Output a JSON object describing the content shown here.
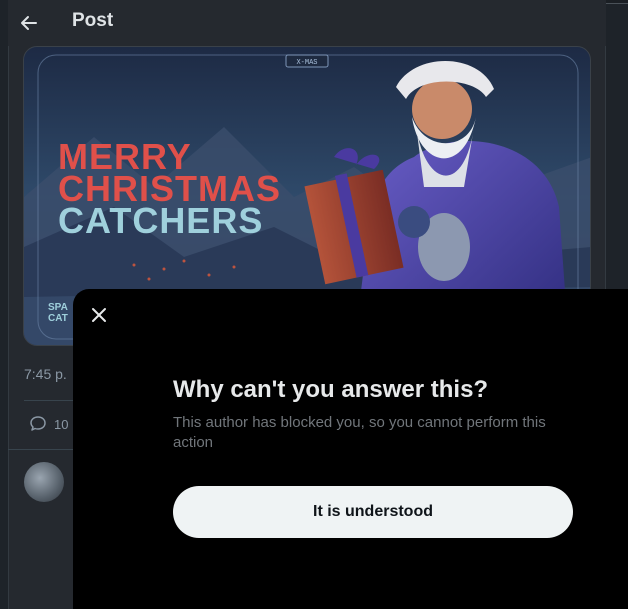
{
  "header": {
    "title": "Post",
    "back_icon": "arrow-left-icon"
  },
  "post": {
    "image": {
      "badge": "X-MAS",
      "headline_line1": "MERRY",
      "headline_line2": "CHRISTMAS",
      "headline_line3": "CATCHERS",
      "corner_text_line1": "SPA",
      "corner_text_line2": "CAT",
      "colors": {
        "red": "#e0504a",
        "cyan": "#9fd0dc"
      }
    },
    "timestamp": "7:45 p.",
    "reply_count": "10",
    "reply_icon": "comment-icon"
  },
  "modal": {
    "close_icon": "close-icon",
    "title": "Why can't you answer this?",
    "description": "This author has blocked you, so you cannot perform this action",
    "button_label": "It is understood"
  }
}
